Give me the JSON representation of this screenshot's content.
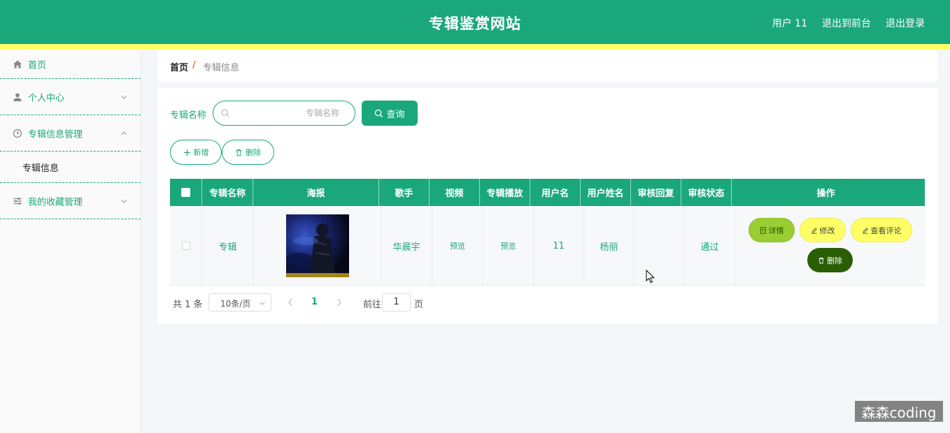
{
  "header": {
    "site_title": "专辑鉴赏网站",
    "links": [
      "用户 11",
      "退出到前台",
      "退出登录"
    ],
    "bg_color": "#1aa87b",
    "stripe_color": "#ffff66"
  },
  "sidebar": {
    "items": [
      {
        "label": "首页",
        "icon": "home-icon"
      },
      {
        "label": "个人中心",
        "icon": "user-icon",
        "arrow": "chevron-down-icon"
      },
      {
        "label": "专辑信息管理",
        "icon": "clock-icon",
        "arrow": "chevron-up-icon",
        "expanded": true
      },
      {
        "label": "我的收藏管理",
        "icon": "sliders-icon",
        "arrow": "chevron-down-icon"
      }
    ],
    "submenu": {
      "label": "专辑信息"
    }
  },
  "breadcrumb": {
    "home": "首页",
    "separator": "/",
    "current": "专辑信息"
  },
  "search": {
    "label": "专辑名称",
    "placeholder": "专辑名称",
    "query_label": "查询"
  },
  "actions": {
    "add_label": "新增",
    "delete_label": "删除"
  },
  "table": {
    "headers": [
      "专辑名称",
      "海报",
      "歌手",
      "视频",
      "专辑播放",
      "用户名",
      "用户姓名",
      "审核回复",
      "审核状态",
      "操作"
    ],
    "rows": [
      {
        "album_name": "专辑",
        "singer": "华晨宇",
        "video": "预览",
        "album_play": "预览",
        "username": "11",
        "user_fullname": "杨丽",
        "review_reply": "",
        "review_status": "通过",
        "ops": {
          "detail": "详情",
          "edit": "修改",
          "comments": "查看评论",
          "delete": "删除"
        }
      }
    ]
  },
  "pagination": {
    "total_text": "共 1 条",
    "page_size": "10条/页",
    "current_page": "1",
    "goto_label": "前往",
    "goto_value": "1",
    "goto_unit": "页"
  },
  "watermark": "森森coding"
}
